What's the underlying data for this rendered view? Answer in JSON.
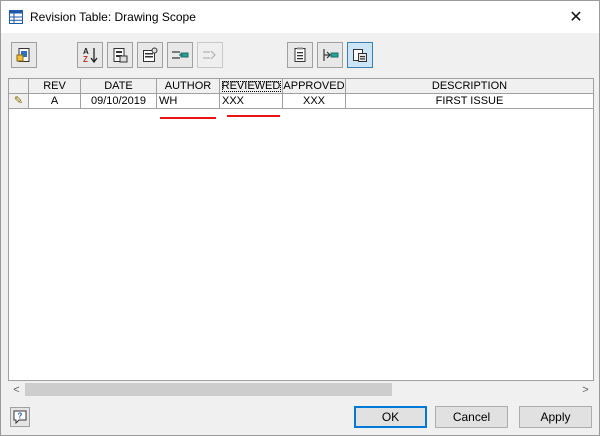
{
  "window": {
    "title": "Revision Table: Drawing Scope",
    "close_glyph": "✕"
  },
  "toolbar": {
    "buttons": [
      {
        "name": "insert-symbol-icon"
      },
      {
        "name": "sort-az-icon"
      },
      {
        "name": "export-icon"
      },
      {
        "name": "properties-icon"
      },
      {
        "name": "insert-row-icon"
      },
      {
        "name": "append-row-icon",
        "disabled": true
      },
      {
        "name": "table-settings-icon"
      },
      {
        "name": "merge-icon"
      },
      {
        "name": "paste-icon",
        "active": true
      }
    ]
  },
  "table": {
    "headers": [
      "REV",
      "DATE",
      "AUTHOR",
      "REVIEWED",
      "APPROVED",
      "DESCRIPTION"
    ],
    "rows": [
      {
        "rev": "A",
        "date": "09/10/2019",
        "author": "WH",
        "reviewed": "XXX",
        "approved": "XXX",
        "description": "FIRST ISSUE"
      }
    ],
    "edit_marker": "✎"
  },
  "annotation_color": "#e8141a",
  "scrollbar": {
    "left_arrow": "<",
    "right_arrow": ">"
  },
  "buttons": {
    "help": "?",
    "ok": "OK",
    "cancel": "Cancel",
    "apply": "Apply"
  }
}
